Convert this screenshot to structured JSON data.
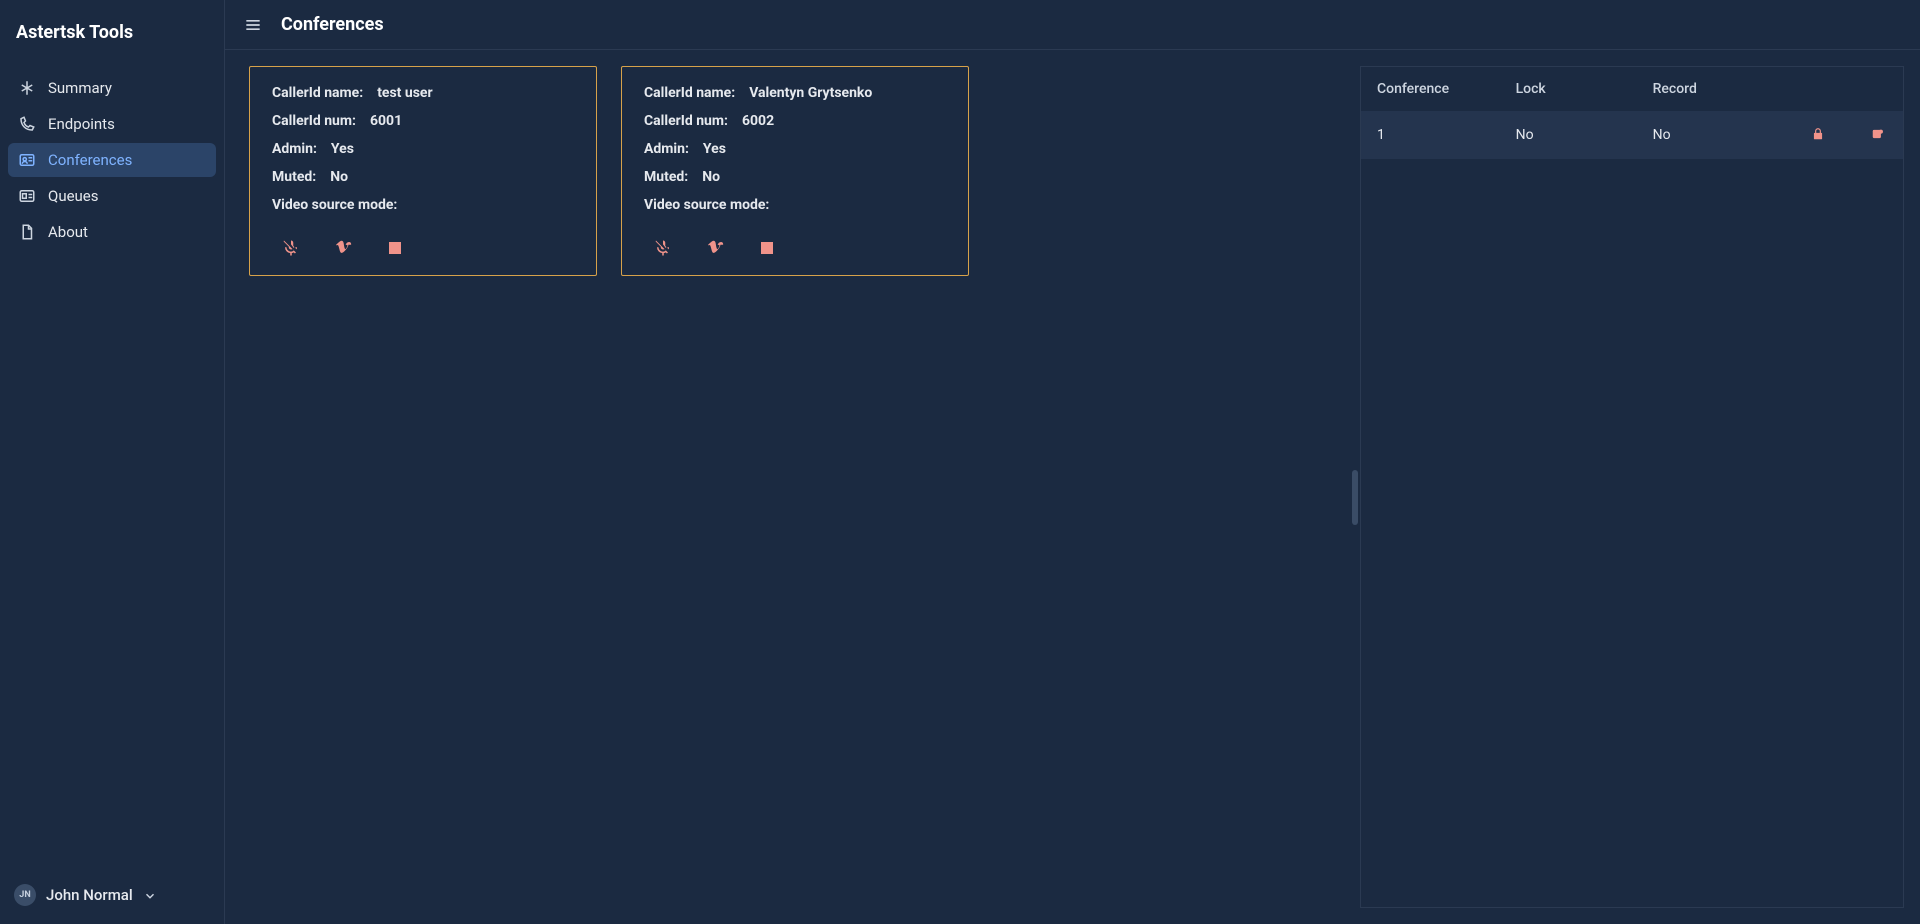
{
  "brand": "Astertsk Tools",
  "sidebar": {
    "items": [
      {
        "label": "Summary",
        "icon": "star"
      },
      {
        "label": "Endpoints",
        "icon": "phone"
      },
      {
        "label": "Conferences",
        "icon": "users"
      },
      {
        "label": "Queues",
        "icon": "id-card"
      },
      {
        "label": "About",
        "icon": "file"
      }
    ],
    "active_index": 2
  },
  "user": {
    "initials": "JN",
    "name": "John Normal"
  },
  "header": {
    "title": "Conferences"
  },
  "labels": {
    "callerid_name": "CallerId name:",
    "callerid_num": "CallerId num:",
    "admin": "Admin:",
    "muted": "Muted:",
    "video_source": "Video source mode:"
  },
  "participants": [
    {
      "name": "test user",
      "num": "6001",
      "admin": "Yes",
      "muted": "No",
      "video_mode": ""
    },
    {
      "name": "Valentyn Grytsenko",
      "num": "6002",
      "admin": "Yes",
      "muted": "No",
      "video_mode": ""
    }
  ],
  "action_icons": {
    "mute": "microphone-slash",
    "video": "vimeo-v",
    "stop": "stop-square"
  },
  "table": {
    "headers": {
      "conference": "Conference",
      "lock": "Lock",
      "record": "Record"
    },
    "rows": [
      {
        "conference": "1",
        "lock": "No",
        "record": "No",
        "icons": {
          "lock": "lock",
          "record": "record-circle"
        }
      }
    ]
  }
}
